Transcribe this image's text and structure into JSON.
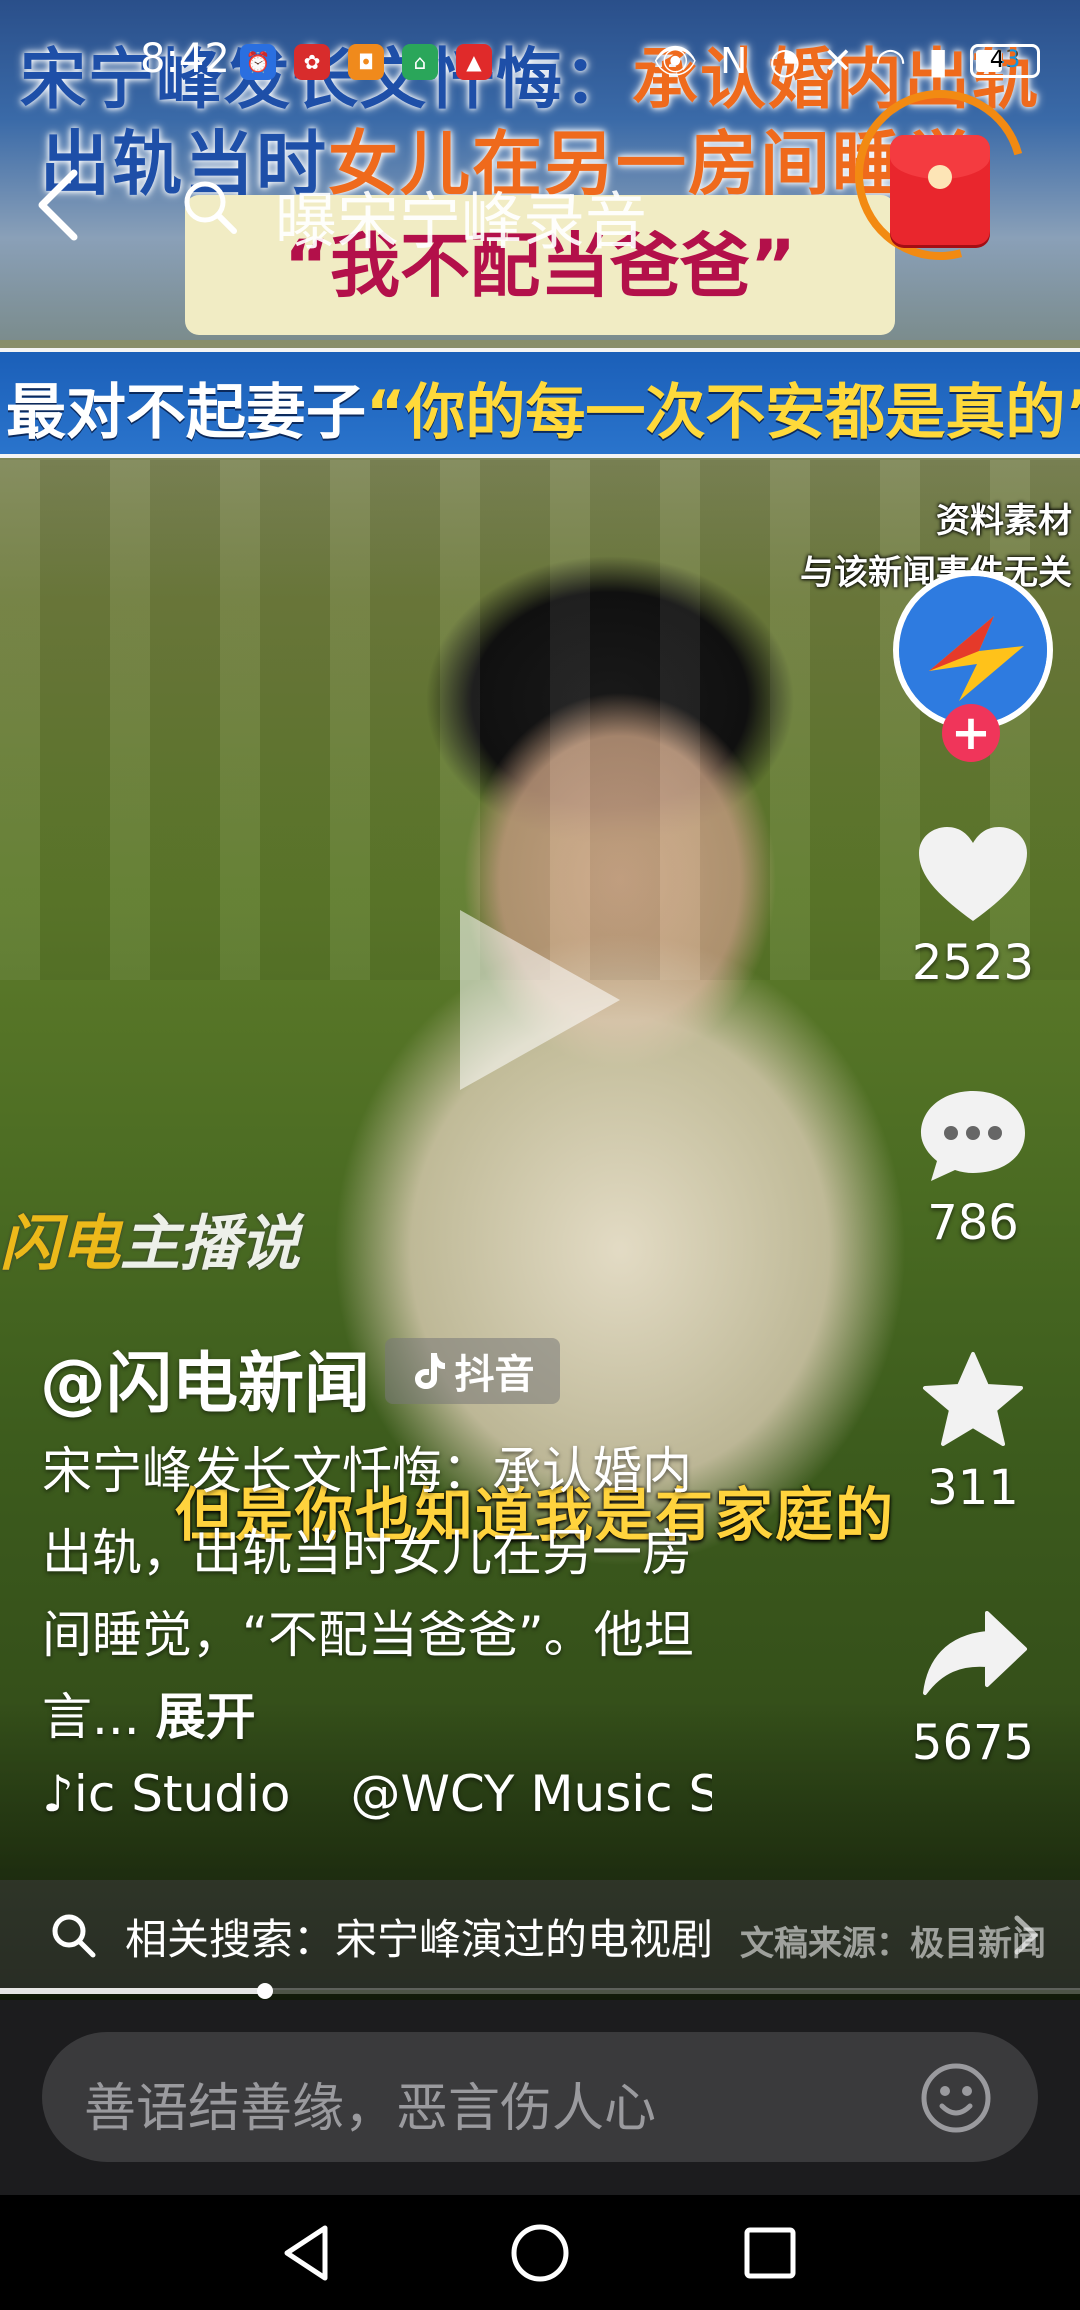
{
  "status_bar": {
    "time": "8:42",
    "battery": "43",
    "app_icons": [
      "alarm-app",
      "huawei-app",
      "orange-app",
      "green-app",
      "red-app"
    ]
  },
  "banner": {
    "line1_a": "宋宁峰发长文忏悔：",
    "line1_b": "承认婚内出轨",
    "line2_a": "出轨当时",
    "line2_b": "女儿在另一房间睡觉",
    "quote": "“我不配当爸爸”",
    "line3_a": "最对不起妻子",
    "line3_b": "“你的每一次不安都是真的”"
  },
  "top_nav": {
    "search_text": "曝宋宁峰录音"
  },
  "source_notice": {
    "line1": "资料素材",
    "line2": "与该新闻事件无关"
  },
  "watermark": {
    "a": "闪电",
    "b": "主播说"
  },
  "subtitle": "但是你也知道我是有家庭的",
  "actions": {
    "likes": "2523",
    "comments": "786",
    "favorites": "311",
    "shares": "5675"
  },
  "post": {
    "author": "@闪电新闻",
    "platform_tag": "抖音",
    "description": "宋宁峰发长文忏悔：承认婚内出轨，出轨当时女儿在另一房间睡觉，“不配当爸爸”。他坦言...",
    "expand": "展开",
    "music_a": "ic Studio",
    "music_b": "@WCY Music St"
  },
  "related": {
    "text": "相关搜索：宋宁峰演过的电视剧",
    "source": "文稿来源：极目新闻"
  },
  "progress": 0.245,
  "comment": {
    "placeholder": "善语结善缘，恶言伤人心"
  },
  "colors": {
    "like_red": "#f0355a",
    "banner_blue": "#1e4fa8",
    "banner_orange": "#ef6a1c",
    "subtitle_yellow": "#ffd33d"
  }
}
